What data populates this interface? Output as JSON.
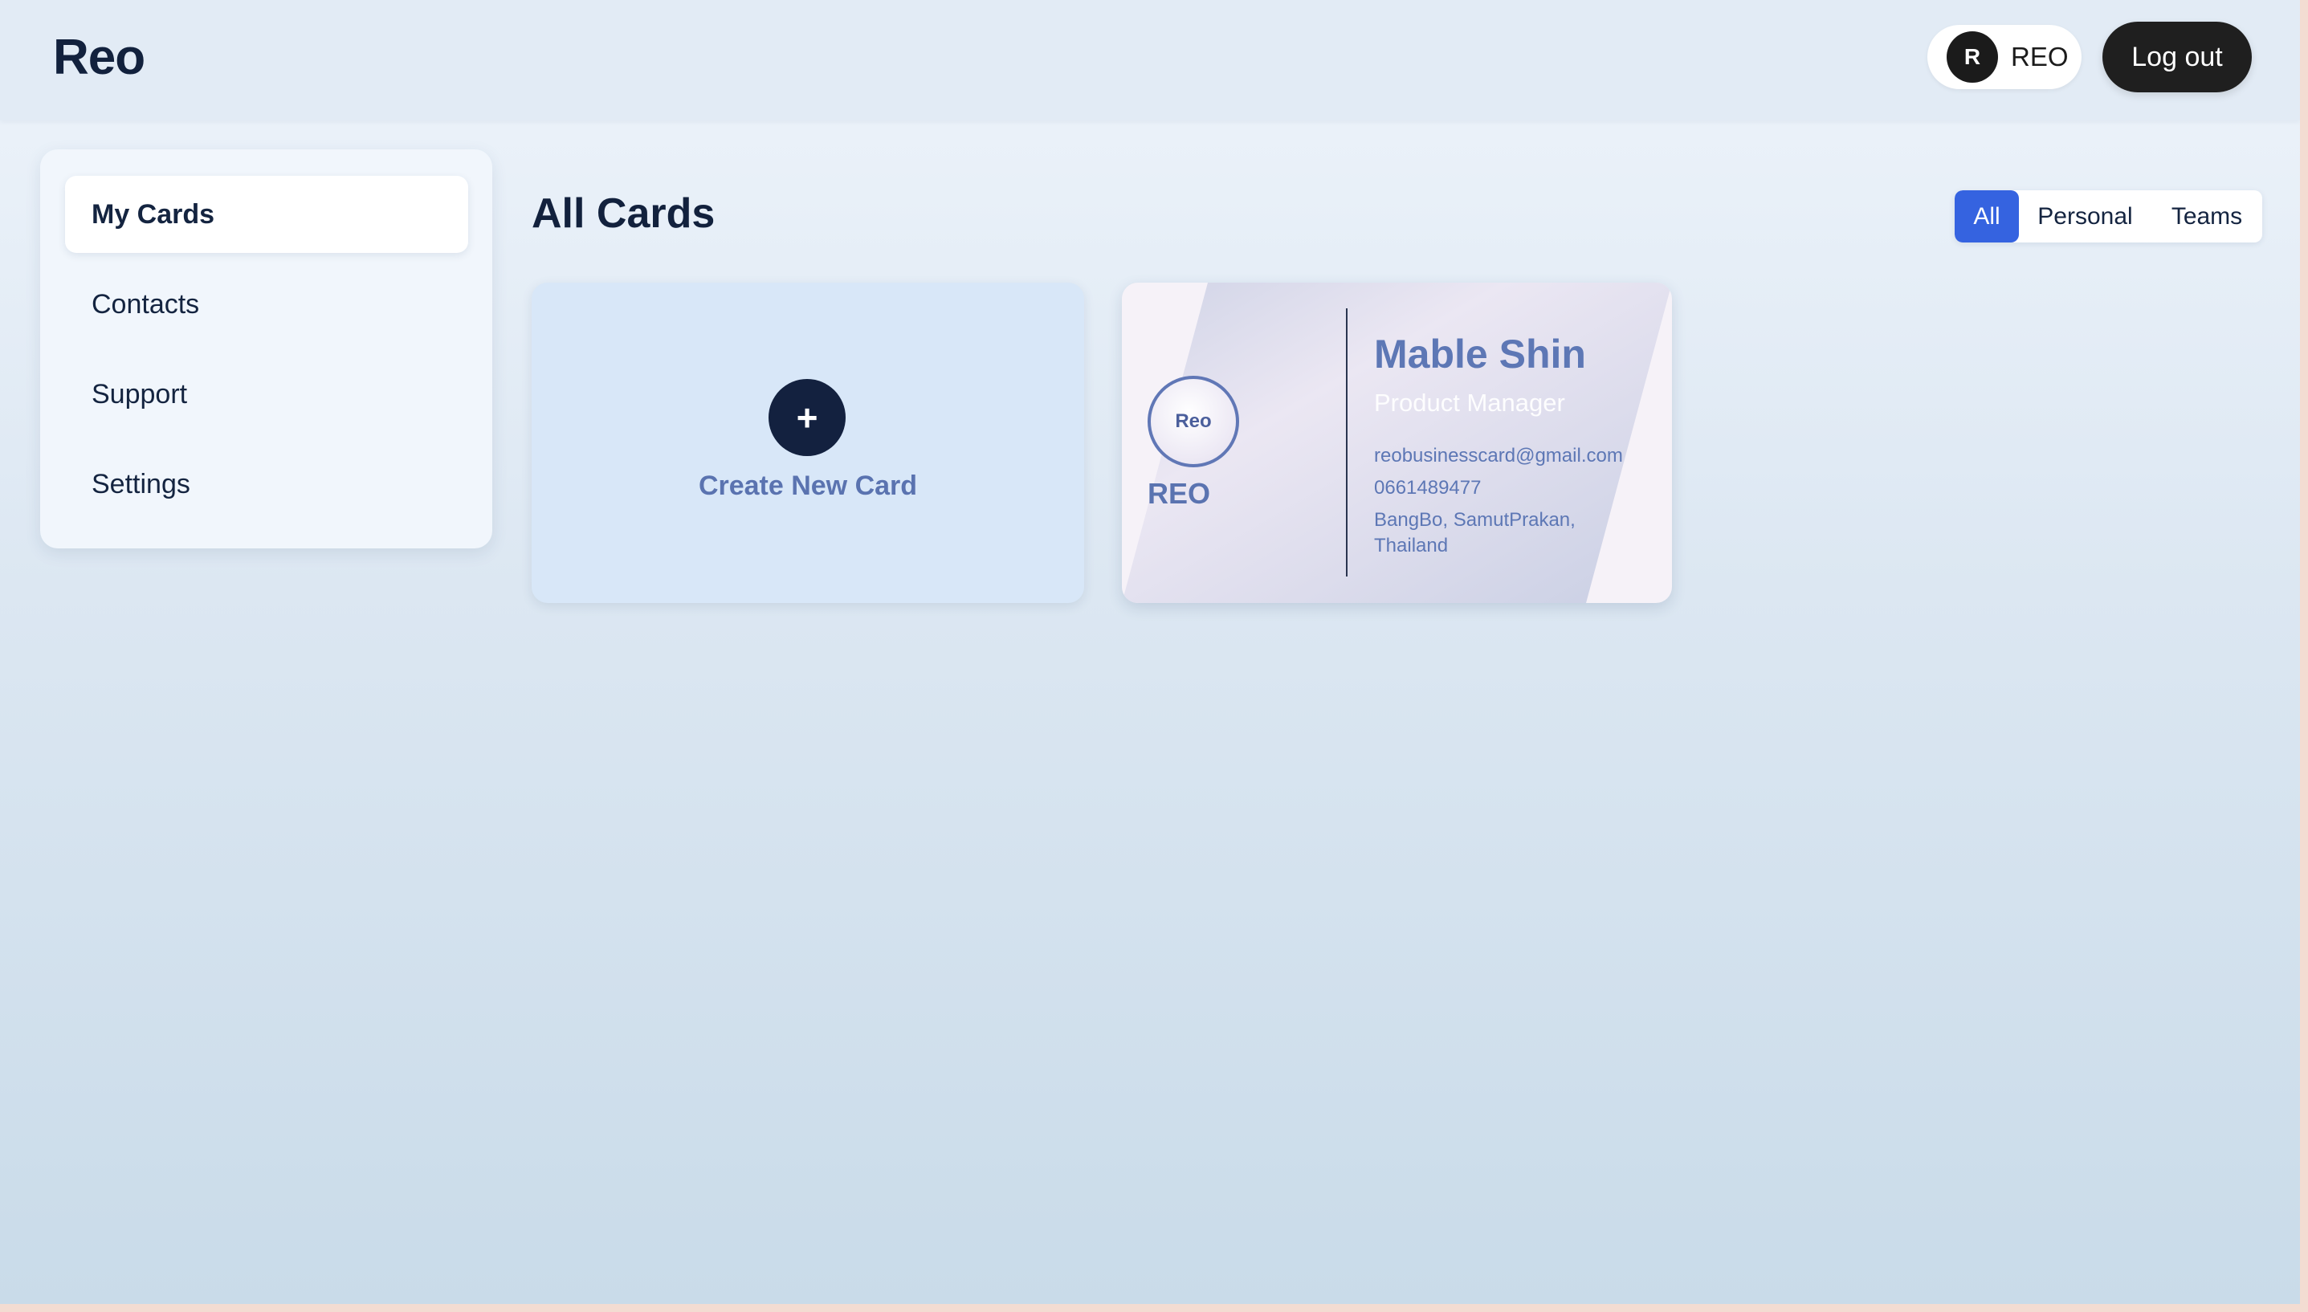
{
  "header": {
    "brand": "Reo",
    "user": {
      "initial": "R",
      "name": "REO"
    },
    "logout_label": "Log out"
  },
  "sidebar": {
    "items": [
      {
        "label": "My Cards",
        "active": true
      },
      {
        "label": "Contacts",
        "active": false
      },
      {
        "label": "Support",
        "active": false
      },
      {
        "label": "Settings",
        "active": false
      }
    ]
  },
  "main": {
    "title": "All Cards",
    "filters": [
      {
        "label": "All",
        "active": true
      },
      {
        "label": "Personal",
        "active": false
      },
      {
        "label": "Teams",
        "active": false
      }
    ],
    "create_card": {
      "icon": "plus-icon",
      "symbol": "+",
      "label": "Create New Card"
    },
    "cards": [
      {
        "logo_text": "Reo",
        "company": "REO",
        "name": "Mable Shin",
        "role": "Product Manager",
        "email": "reobusinesscard@gmail.com",
        "phone": "0661489477",
        "address": "BangBo, SamutPrakan, Thailand"
      }
    ]
  },
  "colors": {
    "accent": "#3563e0",
    "dark": "#1f1f1f",
    "brand_text": "#12213d",
    "card_text": "#5d77b5"
  }
}
